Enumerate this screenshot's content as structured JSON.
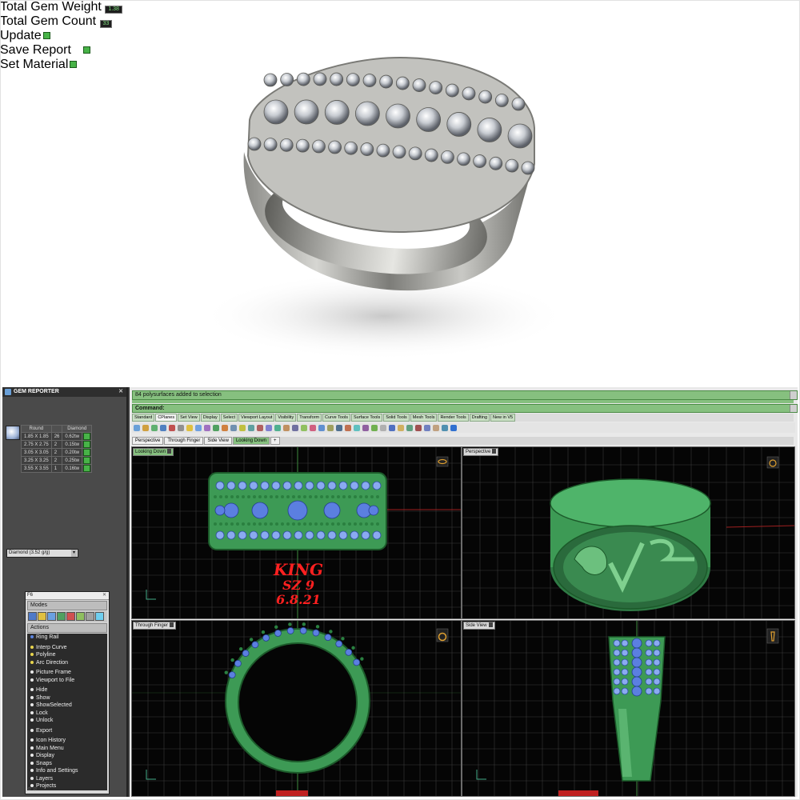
{
  "gem_reporter": {
    "title": "GEM REPORTER",
    "total_weight_label": "Total Gem Weight",
    "total_weight_value": "1.38",
    "total_count_label": "Total Gem Count",
    "total_count_value": "33",
    "update_label": "Update",
    "save_report_label": "Save Report",
    "table_headers": [
      "Round",
      "",
      "Diamond"
    ],
    "rows": [
      {
        "size": "1.85 X 1.85",
        "count": "26",
        "weight": "0.62tw"
      },
      {
        "size": "2.75 X 2.75",
        "count": "2",
        "weight": "0.15tw"
      },
      {
        "size": "3.05 X 3.05",
        "count": "2",
        "weight": "0.20tw"
      },
      {
        "size": "3.25 X 3.25",
        "count": "2",
        "weight": "0.25tw"
      },
      {
        "size": "3.55 X 3.55",
        "count": "1",
        "weight": "0.16tw"
      }
    ],
    "material_value": "Diamond   (3.52 g/g)",
    "set_material_label": "Set Material"
  },
  "tool_panel": {
    "title": "F6",
    "modes_label": "Modes",
    "actions_label": "Actions",
    "groups": [
      [
        {
          "label": "Ring Rail",
          "dot": "b"
        }
      ],
      [
        {
          "label": "Interp Curve",
          "dot": "y"
        },
        {
          "label": "Polyline",
          "dot": "y"
        },
        {
          "label": "Arc Direction",
          "dot": "y"
        }
      ],
      [
        {
          "label": "Picture Frame",
          "dot": "w"
        },
        {
          "label": "Viewport to File",
          "dot": "w"
        }
      ],
      [
        {
          "label": "Hide",
          "dot": "w"
        },
        {
          "label": "Show",
          "dot": "w"
        },
        {
          "label": "ShowSelected",
          "dot": "w"
        },
        {
          "label": "Lock",
          "dot": "w"
        },
        {
          "label": "Unlock",
          "dot": "w"
        }
      ],
      [
        {
          "label": "Export",
          "dot": "w"
        }
      ],
      [
        {
          "label": "Icon History",
          "dot": "w"
        },
        {
          "label": "Main Menu",
          "dot": "w"
        },
        {
          "label": "Display",
          "dot": "w"
        },
        {
          "label": "Snaps",
          "dot": "w"
        },
        {
          "label": "Info and Settings",
          "dot": "w"
        },
        {
          "label": "Layers",
          "dot": "w"
        },
        {
          "label": "Projects",
          "dot": "w"
        }
      ]
    ]
  },
  "main_window": {
    "status_text": "84 polysurfaces added to selection",
    "command_label": "Command:",
    "toolbar_tabs": [
      "Standard",
      "CPlanes",
      "Set View",
      "Display",
      "Select",
      "Viewport Layout",
      "Visibility",
      "Transform",
      "Curve Tools",
      "Surface Tools",
      "Solid Tools",
      "Mesh Tools",
      "Render Tools",
      "Drafting",
      "New in V5"
    ],
    "active_toolbar_tab": "CPlanes",
    "viewport_tabs": [
      "Perspective",
      "Through Finger",
      "Side View",
      "Looking Down",
      "+"
    ],
    "active_viewport_tab": "Looking Down"
  },
  "viewports": {
    "top_left": {
      "label": "Looking Down",
      "engraving": [
        "KING",
        "SZ 9",
        "6.8.21"
      ]
    },
    "top_right": {
      "label": "Perspective"
    },
    "bottom_left": {
      "label": "Through Finger"
    },
    "bottom_right": {
      "label": "Side View"
    }
  },
  "colors": {
    "ring_green": "#3d9a55",
    "gem_blue": "#5b7fe0",
    "engraving_red": "#ff2020",
    "rhino_green": "#86c07f"
  }
}
